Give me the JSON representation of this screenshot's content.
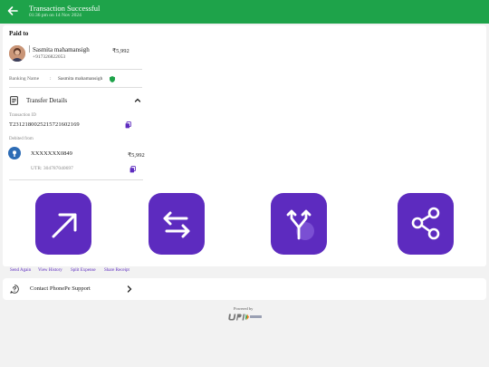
{
  "header": {
    "title": "Transaction Successful",
    "subtitle": "01:36 pm on 14 Nov 2024",
    "icons": {
      "back": "arrow-left-icon"
    }
  },
  "paid_to": {
    "heading": "Paid to",
    "name": "Sasmita mahamansigh",
    "phone": "+917326822053",
    "amount": "₹5,992",
    "banking_name_label": "Banking Name",
    "banking_name_separator": ":",
    "banking_name_value": "Sasmita mahamansigh"
  },
  "transfer": {
    "label": "Transfer Details",
    "transaction_id_label": "Transaction ID",
    "transaction_id": "T2312180025215721602169",
    "debited_from_label": "Debited from",
    "account": "XXXXXXX0849",
    "amount": "₹5,992",
    "utr": "UTR: 304787040697"
  },
  "actions": [
    {
      "label": "Send Again",
      "icon": "arrow-up-right-icon"
    },
    {
      "label": "View History",
      "icon": "swap-arrows-icon"
    },
    {
      "label": "Split Expense",
      "icon": "split-arrows-icon"
    },
    {
      "label": "Share Receipt",
      "icon": "share-icon"
    }
  ],
  "support": {
    "label": "Contact PhonePe Support",
    "icon": "help-circle-icon"
  },
  "footer": {
    "powered_by": "Powered by"
  },
  "colors": {
    "header": "#1ea34a",
    "accent": "#5d2bbf"
  }
}
